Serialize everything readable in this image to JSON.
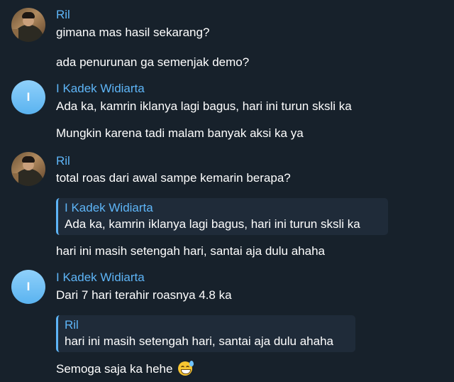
{
  "messages": [
    {
      "sender": "Ril",
      "avatar": "photo",
      "lines": [
        "gimana mas hasil sekarang?",
        "ada penurunan ga semenjak demo?"
      ]
    },
    {
      "sender": "I Kadek Widiarta",
      "avatar_initial": "I",
      "lines": [
        "Ada ka,  kamrin iklanya lagi bagus, hari ini turun sksli ka",
        "Mungkin karena tadi malam banyak aksi ka ya"
      ]
    },
    {
      "sender": "Ril",
      "avatar": "photo",
      "text": "total roas dari awal sampe kemarin berapa?",
      "reply": {
        "name": "I Kadek Widiarta",
        "text": "Ada ka,  kamrin iklanya lagi bagus, hari ini turun sksli ka"
      },
      "after_reply": "hari ini masih setengah hari, santai aja dulu ahaha"
    },
    {
      "sender": "I Kadek Widiarta",
      "avatar_initial": "I",
      "text": "Dari 7 hari terahir roasnya 4.8 ka",
      "reply": {
        "name": "Ril",
        "text": "hari ini masih setengah hari, santai aja dulu ahaha"
      },
      "after_reply": "Semoga saja ka hehe",
      "emoji": "grinning-sweat-emoji"
    }
  ],
  "colors": {
    "background": "#17212b",
    "accent": "#5eb5f7",
    "reply_background": "#1f2b39",
    "text": "#ffffff"
  }
}
